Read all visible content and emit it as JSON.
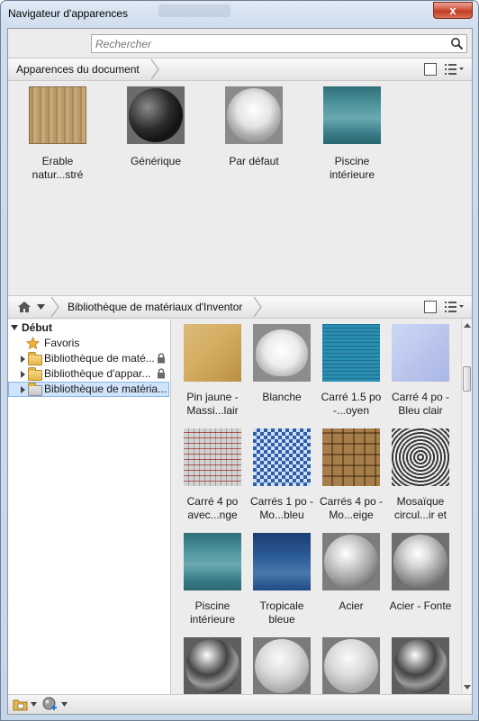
{
  "window": {
    "title": "Navigateur d'apparences",
    "close_glyph": "x"
  },
  "search": {
    "placeholder": "Rechercher"
  },
  "document_section": {
    "breadcrumb": "Apparences du document",
    "items": [
      {
        "label": "Erable natur...stré",
        "thumb": "wood"
      },
      {
        "label": "Générique",
        "thumb": "dark-sphere"
      },
      {
        "label": "Par défaut",
        "thumb": "white-sphere"
      },
      {
        "label": "Piscine intérieure",
        "thumb": "water"
      }
    ]
  },
  "library_section": {
    "breadcrumb": "Bibliothèque de matériaux d'Inventor",
    "tree": {
      "root": "Début",
      "items": [
        {
          "label": "Favoris",
          "icon": "star-icon",
          "locked": false
        },
        {
          "label": "Bibliothèque de maté...",
          "icon": "folder-icon",
          "locked": true
        },
        {
          "label": "Bibliothèque d'appar...",
          "icon": "folder-icon",
          "locked": true
        },
        {
          "label": "Bibliothèque de matéria...",
          "icon": "folder-icon",
          "locked": false,
          "selected": true
        }
      ]
    },
    "materials": [
      {
        "label": "Pin jaune - Massi...lair",
        "thumb": "wood-cube"
      },
      {
        "label": "Blanche",
        "thumb": "bowl"
      },
      {
        "label": "Carré 1.5 po -...oyen",
        "thumb": "tile-blue"
      },
      {
        "label": "Carré 4 po - Bleu clair",
        "thumb": "tile-lightblue"
      },
      {
        "label": "Carré 4 po avec...nge",
        "thumb": "tile-white"
      },
      {
        "label": "Carrés 1 po - Mo...bleu",
        "thumb": "tile-bluemix"
      },
      {
        "label": "Carrés 4 po - Mo...eige",
        "thumb": "tile-beige"
      },
      {
        "label": "Mosaïque circul...ir et",
        "thumb": "mosaic"
      },
      {
        "label": "Piscine intérieure",
        "thumb": "water"
      },
      {
        "label": "Tropicale bleue",
        "thumb": "water-deep"
      },
      {
        "label": "Acier",
        "thumb": "steel-sphere"
      },
      {
        "label": "Acier - Fonte",
        "thumb": "cast-sphere"
      },
      {
        "label": "",
        "thumb": "chrome-sphere"
      },
      {
        "label": "",
        "thumb": "matte-sphere"
      },
      {
        "label": "",
        "thumb": "matte-sphere"
      },
      {
        "label": "",
        "thumb": "chrome-sphere"
      }
    ]
  },
  "icons": {
    "search": "search-icon",
    "home": "home-icon",
    "view_toggle": "panel-view-icon",
    "list_options": "list-options-icon",
    "library_manager": "library-manager-icon",
    "create_material": "create-material-icon"
  }
}
